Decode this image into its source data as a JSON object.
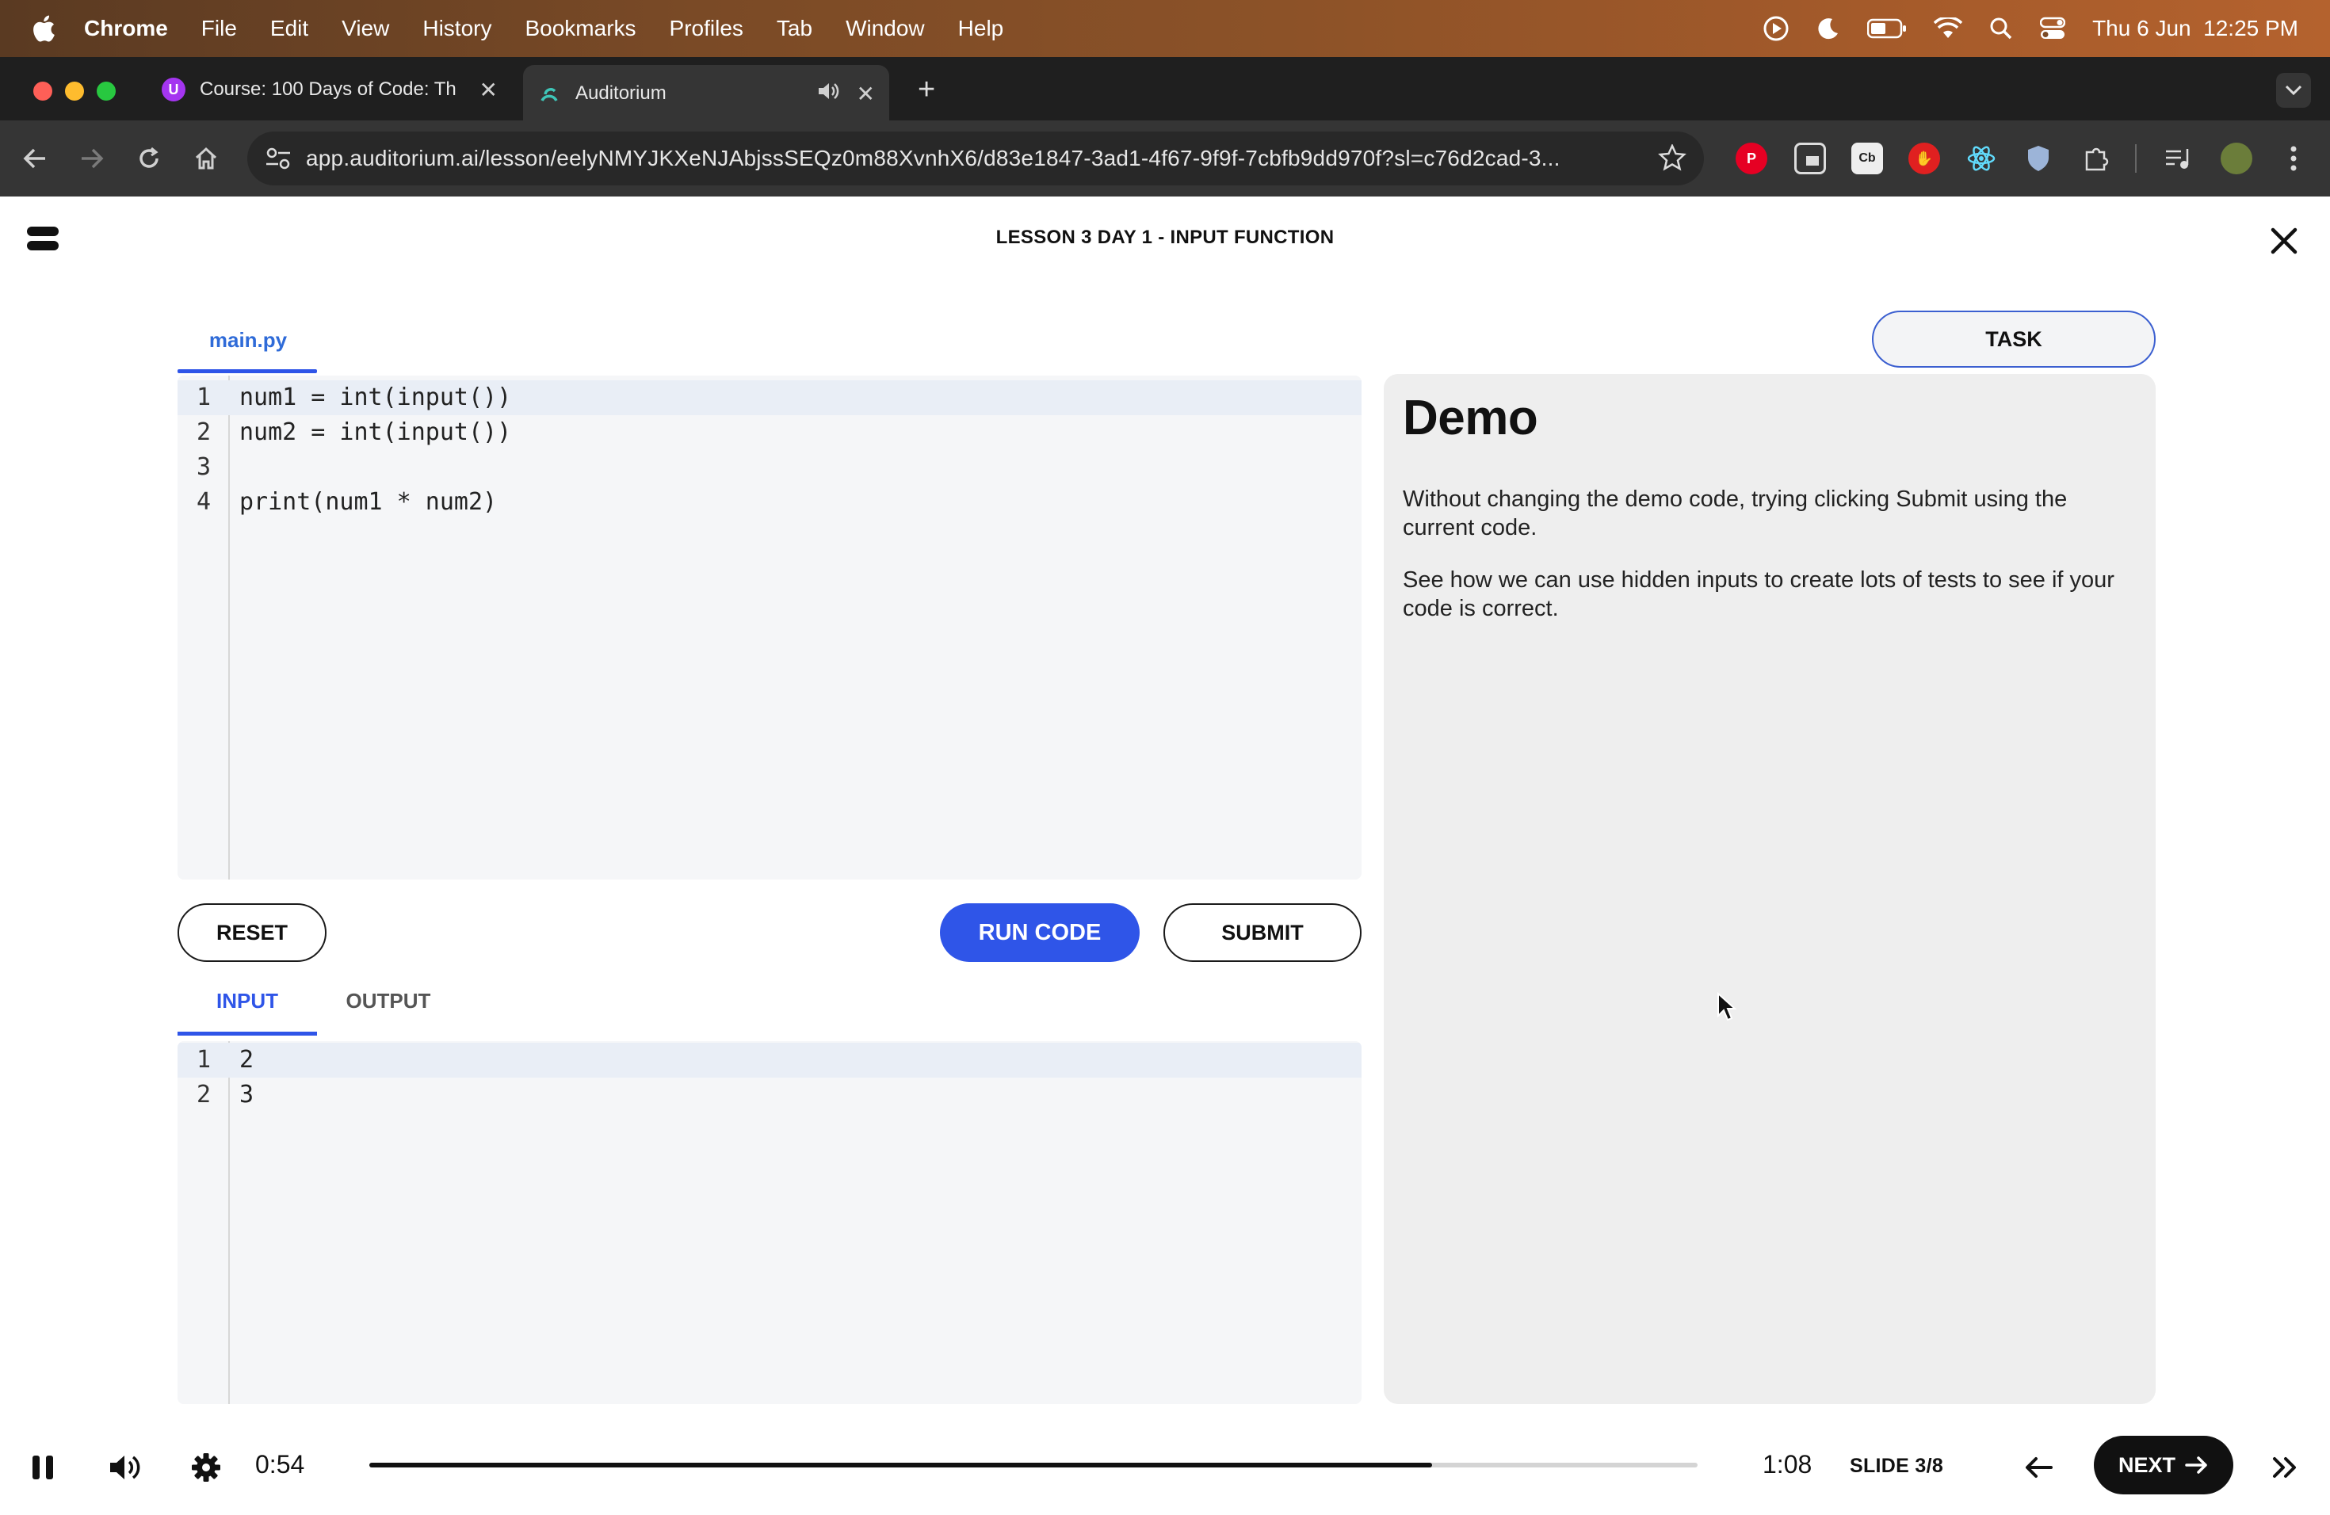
{
  "menubar": {
    "app_name": "Chrome",
    "items": [
      "File",
      "Edit",
      "View",
      "History",
      "Bookmarks",
      "Profiles",
      "Tab",
      "Window",
      "Help"
    ],
    "clock": "Thu 6 Jun  12:25 PM"
  },
  "browser": {
    "tabs": [
      {
        "title": "Course: 100 Days of Code: Th",
        "favicon": "udemy-icon",
        "active": false
      },
      {
        "title": "Auditorium",
        "favicon": "auditorium-icon",
        "active": true
      }
    ],
    "url": "app.auditorium.ai/lesson/eelyNMYJKXeNJAbjssSEQz0m88XvnhX6/d83e1847-3ad1-4f67-9f9f-7cbfb9dd970f?sl=c76d2cad-3..."
  },
  "lesson": {
    "title": "LESSON 3 DAY 1 - INPUT FUNCTION"
  },
  "editor": {
    "file_tab": "main.py",
    "lines": [
      {
        "n": "1",
        "code": "num1 = int(input())"
      },
      {
        "n": "2",
        "code": "num2 = int(input())"
      },
      {
        "n": "3",
        "code": ""
      },
      {
        "n": "4",
        "code": "print(num1 * num2)"
      }
    ]
  },
  "buttons": {
    "reset": "RESET",
    "run": "RUN CODE",
    "submit": "SUBMIT",
    "task": "TASK",
    "next": "NEXT"
  },
  "io": {
    "input_tab": "INPUT",
    "output_tab": "OUTPUT",
    "input_lines": [
      {
        "n": "1",
        "code": "2"
      },
      {
        "n": "2",
        "code": "3"
      }
    ]
  },
  "task": {
    "heading": "Demo",
    "paragraphs": [
      "Without changing the demo code, trying clicking Submit using the current code.",
      "See how we can use hidden inputs to create lots of tests to see if your code is correct."
    ]
  },
  "player": {
    "current_time": "0:54",
    "total_time": "1:08",
    "progress_fraction": 0.8,
    "slide": "SLIDE 3/8"
  },
  "colors": {
    "accent": "#2f55e8",
    "panel": "#eeeeee",
    "editor_bg": "#f5f6f8"
  }
}
